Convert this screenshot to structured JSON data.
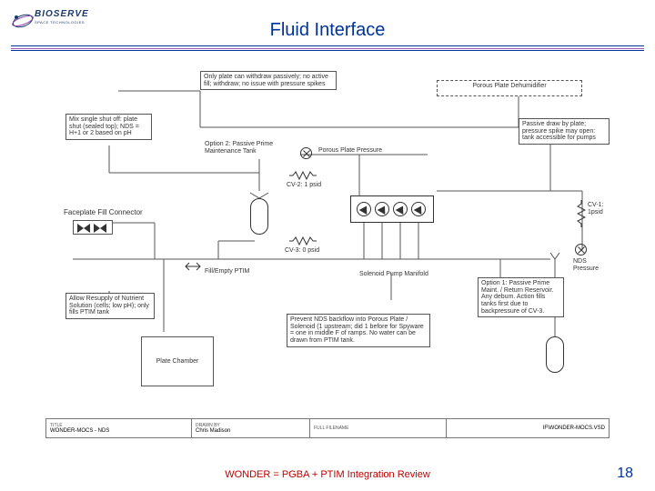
{
  "logo": {
    "brand": "BIOSERVE",
    "tagline": "SPACE TECHNOLOGIES"
  },
  "title": "Fluid Interface",
  "boxes": {
    "top_note": "Only plate can withdraw passively; no active fill; withdraw; no issue with pressure spikes",
    "mix_shutoff": "Mix single shut off: plate shut (sealed top); NDS = H+1 or 2 based on pH",
    "dehumidifier": "Porous Plate Dehumidifier",
    "passive_draw": "Passive draw by plate; pressure spike may open: tank accessible for pumps",
    "resupply": "Allow Resupply of Nutrient Solution (cells; low pH); only fills PTIM tank",
    "plate_chamber": "Plate Chamber",
    "bottom_note": "Prevent NDS backflow into Porous Plate / Solenoid (1 upstream; did 1 before for Spyware = one in middle F of ramps. No water can be drawn from PTIM tank.",
    "option1": "Option 1: Passive Prime Maint. / Return Reservoir. Any debum. Action fills tanks first due to backpressure of CV-3."
  },
  "labels": {
    "option2": "Option 2: Passive Prime Maintenance Tank",
    "porous_pressure": "Porous Plate Pressure",
    "cv2": "CV-2: 1 psid",
    "cv3": "CV-3: 0 psid",
    "cv1": "CV-1: 1psid",
    "faceplate": "Faceplate Fill Connector",
    "fill_empty": "Fill/Empty PTIM",
    "manifold": "Solenoid Pump Manifold",
    "nds": "NDS Pressure"
  },
  "titleblock": {
    "title_h": "TITLE",
    "title": "WONDER-MOCS - NDS",
    "drawn_h": "DRAWN BY",
    "drawn": "Chris Madison",
    "file_h": "FULL FILENAME",
    "file": "",
    "path_h": "",
    "path": "IF\\WONDER-MOCS.VSD"
  },
  "footer": "WONDER  = PGBA + PTIM Integration Review",
  "page": "18"
}
